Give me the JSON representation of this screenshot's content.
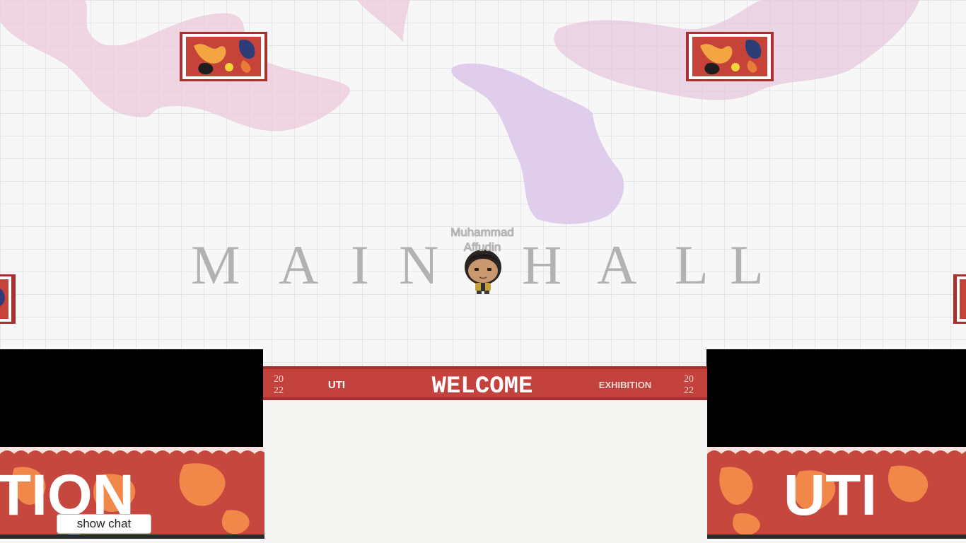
{
  "room": {
    "floor_title_letters": [
      "M",
      "A",
      "I",
      "N",
      "H",
      "A",
      "L",
      "L"
    ],
    "floor_title": "MAIN HALL"
  },
  "player": {
    "name_line1": "Muhammad",
    "name_line2": "Affudin"
  },
  "banners": {
    "welcome": {
      "year_left_top": "20",
      "year_left_bottom": "22",
      "brand": "UTI",
      "title": "WELCOME",
      "subtitle": "EXHIBITION",
      "year_right_top": "20",
      "year_right_bottom": "22"
    },
    "left_side_text": "TION",
    "right_side_text": "UTI"
  },
  "controls": {
    "show_chat_label": "show chat"
  },
  "colors": {
    "banner_red": "#c3423d",
    "banner_orange": "#f2874a",
    "blob_pink": "#ecc9d9",
    "blob_purple": "#dcc5ea",
    "floor_text": "#b2b2b2"
  }
}
